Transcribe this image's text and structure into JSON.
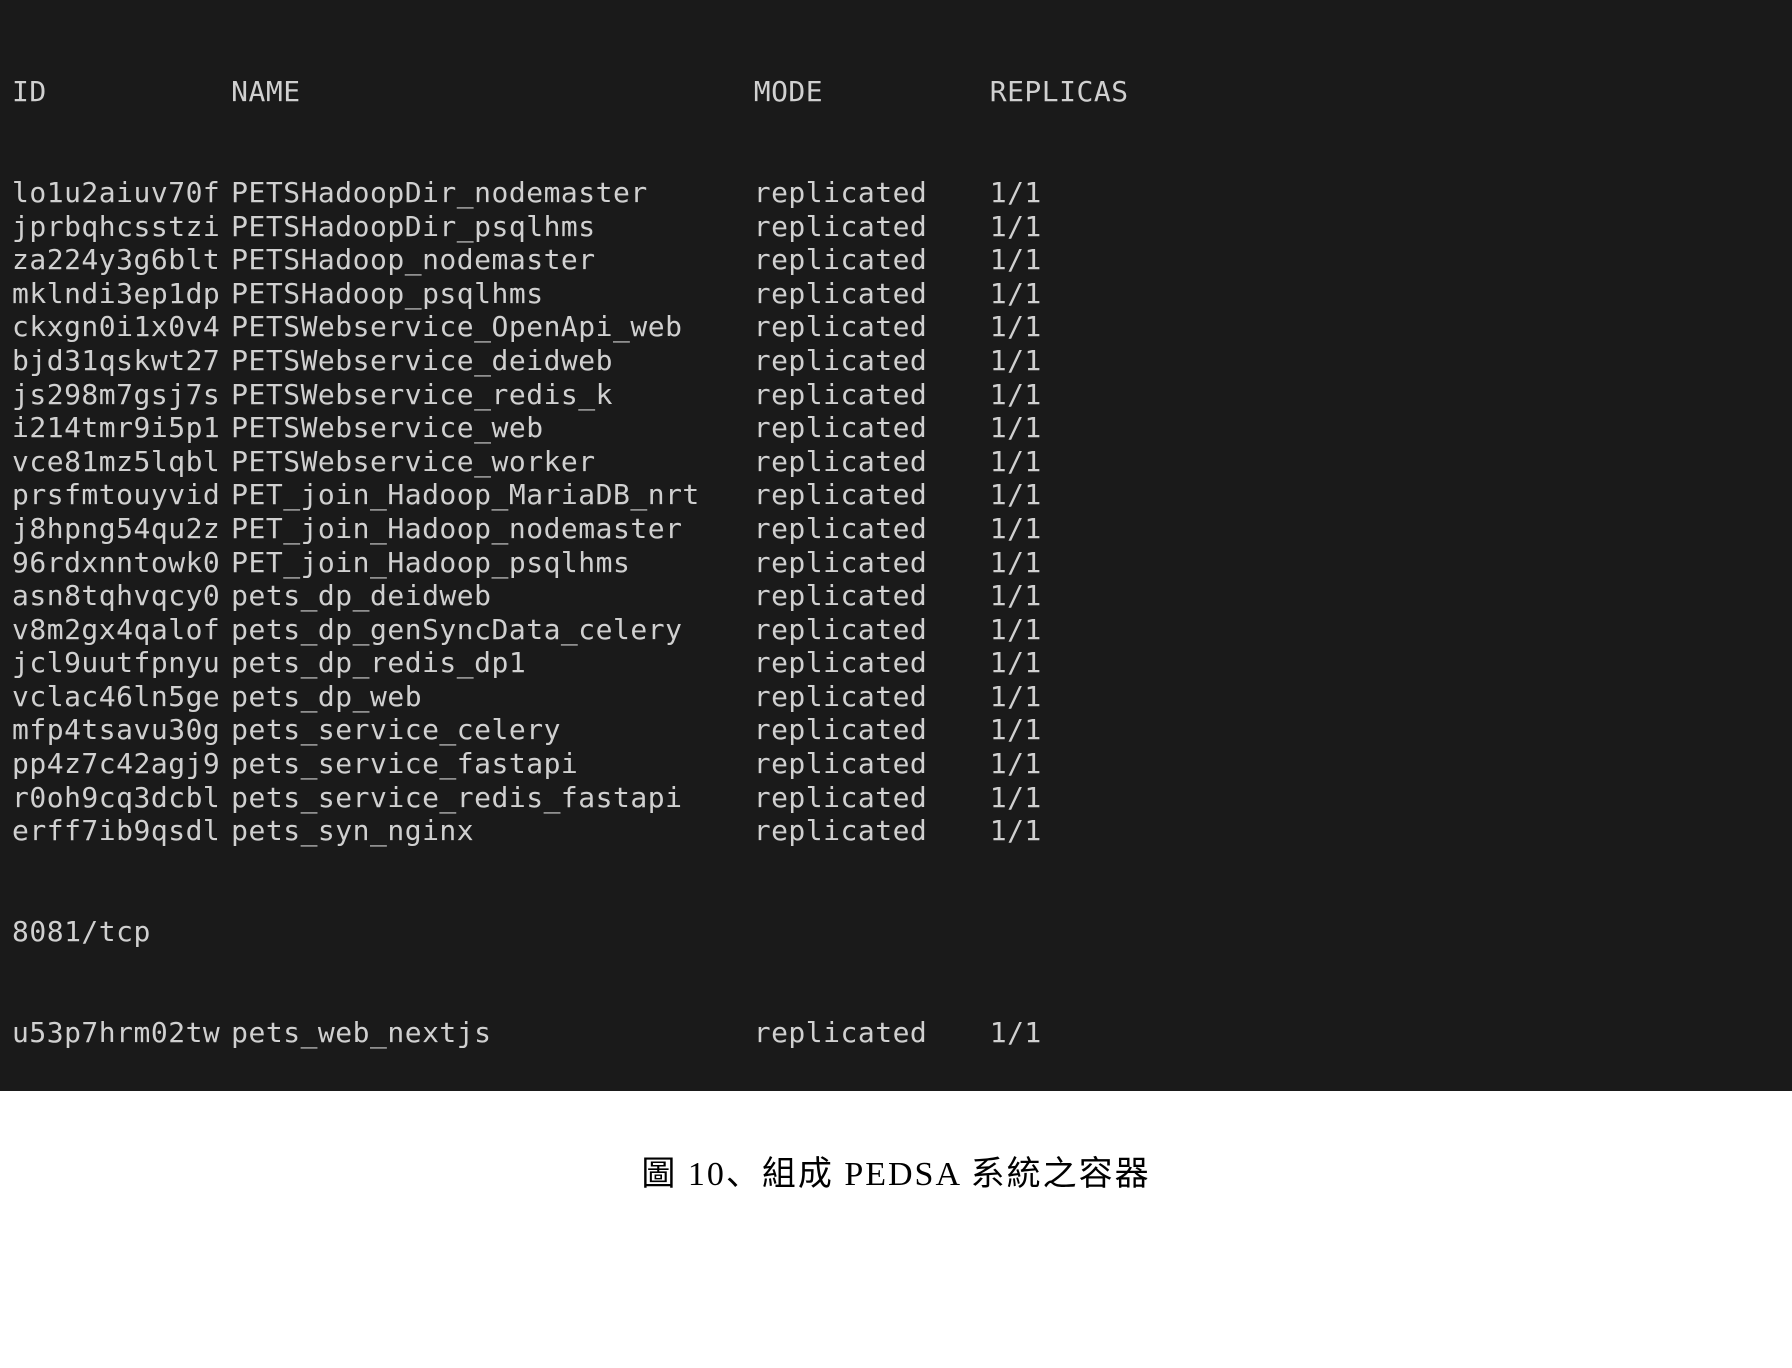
{
  "header": {
    "id": "ID",
    "name": "NAME",
    "mode": "MODE",
    "replicas": "REPLICAS"
  },
  "rows": [
    {
      "id": "lo1u2aiuv70f",
      "name": "PETSHadoopDir_nodemaster",
      "mode": "replicated",
      "replicas": "1/1"
    },
    {
      "id": "jprbqhcsstzi",
      "name": "PETSHadoopDir_psqlhms",
      "mode": "replicated",
      "replicas": "1/1"
    },
    {
      "id": "za224y3g6blt",
      "name": "PETSHadoop_nodemaster",
      "mode": "replicated",
      "replicas": "1/1"
    },
    {
      "id": "mklndi3ep1dp",
      "name": "PETSHadoop_psqlhms",
      "mode": "replicated",
      "replicas": "1/1"
    },
    {
      "id": "ckxgn0i1x0v4",
      "name": "PETSWebservice_OpenApi_web",
      "mode": "replicated",
      "replicas": "1/1"
    },
    {
      "id": "bjd31qskwt27",
      "name": "PETSWebservice_deidweb",
      "mode": "replicated",
      "replicas": "1/1"
    },
    {
      "id": "js298m7gsj7s",
      "name": "PETSWebservice_redis_k",
      "mode": "replicated",
      "replicas": "1/1"
    },
    {
      "id": "i214tmr9i5p1",
      "name": "PETSWebservice_web",
      "mode": "replicated",
      "replicas": "1/1"
    },
    {
      "id": "vce81mz5lqbl",
      "name": "PETSWebservice_worker",
      "mode": "replicated",
      "replicas": "1/1"
    },
    {
      "id": "prsfmtouyvid",
      "name": "PET_join_Hadoop_MariaDB_nrt",
      "mode": "replicated",
      "replicas": "1/1"
    },
    {
      "id": "j8hpng54qu2z",
      "name": "PET_join_Hadoop_nodemaster",
      "mode": "replicated",
      "replicas": "1/1"
    },
    {
      "id": "96rdxnntowk0",
      "name": "PET_join_Hadoop_psqlhms",
      "mode": "replicated",
      "replicas": "1/1"
    },
    {
      "id": "asn8tqhvqcy0",
      "name": "pets_dp_deidweb",
      "mode": "replicated",
      "replicas": "1/1"
    },
    {
      "id": "v8m2gx4qalof",
      "name": "pets_dp_genSyncData_celery",
      "mode": "replicated",
      "replicas": "1/1"
    },
    {
      "id": "jcl9uutfpnyu",
      "name": "pets_dp_redis_dp1",
      "mode": "replicated",
      "replicas": "1/1"
    },
    {
      "id": "vclac46ln5ge",
      "name": "pets_dp_web",
      "mode": "replicated",
      "replicas": "1/1"
    },
    {
      "id": "mfp4tsavu30g",
      "name": "pets_service_celery",
      "mode": "replicated",
      "replicas": "1/1"
    },
    {
      "id": "pp4z7c42agj9",
      "name": "pets_service_fastapi",
      "mode": "replicated",
      "replicas": "1/1"
    },
    {
      "id": "r0oh9cq3dcbl",
      "name": "pets_service_redis_fastapi",
      "mode": "replicated",
      "replicas": "1/1"
    },
    {
      "id": "erff7ib9qsdl",
      "name": "pets_syn_nginx",
      "mode": "replicated",
      "replicas": "1/1"
    }
  ],
  "wrapped_line": "8081/tcp",
  "last_row": {
    "id": "u53p7hrm02tw",
    "name": "pets_web_nextjs",
    "mode": "replicated",
    "replicas": "1/1"
  },
  "caption": "圖 10、組成 PEDSA 系統之容器"
}
